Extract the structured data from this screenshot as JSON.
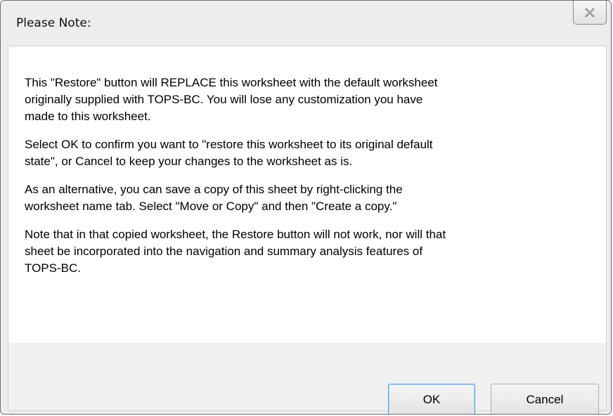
{
  "window": {
    "title": "Please Note:",
    "close_icon": "close-x-icon"
  },
  "message": {
    "paragraphs": [
      "This \"Restore\" button will REPLACE this worksheet with the default worksheet originally supplied with TOPS-BC.  You will lose any customization you have made to this worksheet.",
      "Select OK to confirm you want to \"restore this worksheet to its original default state\", or Cancel to keep your changes to the worksheet as is.",
      "As an alternative, you can save a copy of this sheet by right-clicking the worksheet name tab.  Select \"Move or Copy\" and then \"Create a copy.\"",
      "Note that  in that copied worksheet, the Restore button will not work, nor will that sheet be incorporated into the navigation and summary analysis features of TOPS-BC."
    ],
    "lines": [
      [
        "This \"Restore\" button will REPLACE this worksheet with the default worksheet",
        "originally supplied with TOPS-BC.  You will lose any customization you have",
        "made to this worksheet."
      ],
      [
        "Select OK to confirm you want to \"restore this worksheet to its original default",
        "state\", or Cancel to keep your changes to the worksheet as is."
      ],
      [
        "As an alternative, you can save a copy of this sheet by right-clicking the",
        "worksheet name tab.  Select \"Move or Copy\" and then \"Create a copy.\""
      ],
      [
        "Note that  in that copied worksheet, the Restore button will not work, nor will that",
        "sheet be incorporated into the navigation and summary analysis features of",
        "TOPS-BC."
      ]
    ]
  },
  "buttons": {
    "ok_label": "OK",
    "cancel_label": "Cancel"
  },
  "colors": {
    "default_button_border": "#5a9ad8",
    "window_border": "#6f6f6f"
  }
}
